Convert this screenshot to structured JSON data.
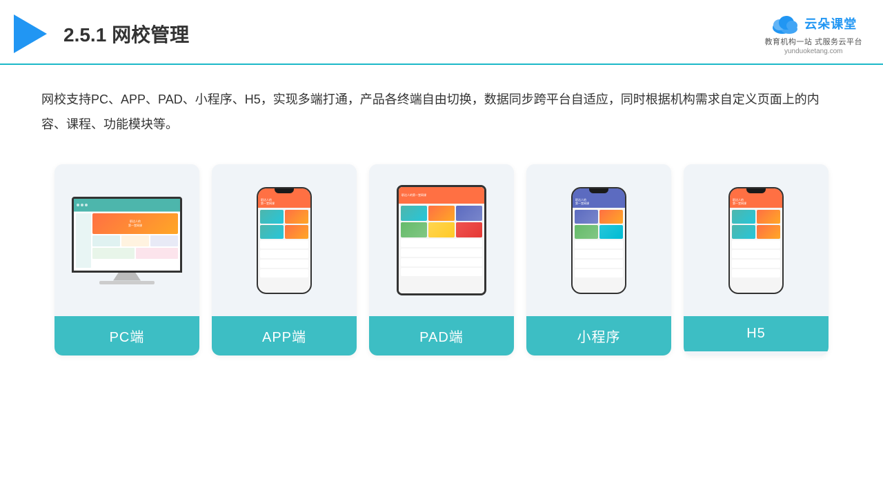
{
  "header": {
    "section_number": "2.5.1",
    "title": "网校管理",
    "logo_main": "云朵课堂",
    "logo_url": "yunduoketang.com",
    "logo_tagline_line1": "教育机构一站",
    "logo_tagline_line2": "式服务云平台"
  },
  "description": {
    "text": "网校支持PC、APP、PAD、小程序、H5，实现多端打通，产品各终端自由切换，数据同步跨平台自适应，同时根据机构需求自定义页面上的内容、课程、功能模块等。"
  },
  "cards": [
    {
      "id": "pc",
      "label": "PC端"
    },
    {
      "id": "app",
      "label": "APP端"
    },
    {
      "id": "pad",
      "label": "PAD端"
    },
    {
      "id": "miniprogram",
      "label": "小程序"
    },
    {
      "id": "h5",
      "label": "H5"
    }
  ],
  "colors": {
    "teal": "#3dbec4",
    "blue": "#2196f3",
    "accent_line": "#1cb8c8"
  }
}
